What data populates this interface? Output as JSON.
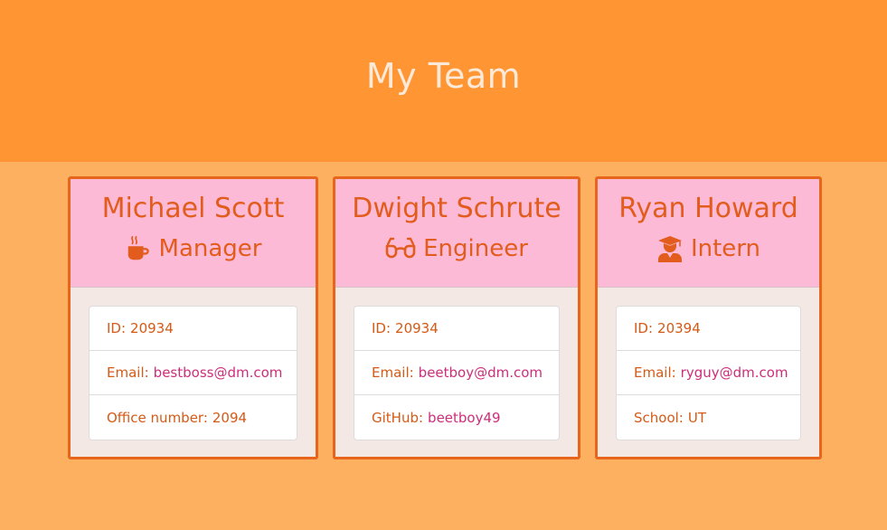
{
  "header": {
    "title": "My Team"
  },
  "colors": {
    "header_bg": "#ff9533",
    "page_bg": "#fdb160",
    "card_head_bg": "#fdbad6",
    "card_border": "#e8651c",
    "text_orange": "#e25c1d",
    "link_pink": "#cc2e7a"
  },
  "members": [
    {
      "name": "Michael Scott",
      "role": "Manager",
      "role_icon": "mug-hot-icon",
      "id_label": "ID:",
      "id": "20934",
      "email_label": "Email:",
      "email": "bestboss@dm.com",
      "extra_label": "Office number:",
      "extra_value": "2094"
    },
    {
      "name": "Dwight Schrute",
      "role": "Engineer",
      "role_icon": "glasses-icon",
      "id_label": "ID:",
      "id": "20934",
      "email_label": "Email:",
      "email": "beetboy@dm.com",
      "extra_label": "GitHub:",
      "extra_value": "beetboy49"
    },
    {
      "name": "Ryan Howard",
      "role": "Intern",
      "role_icon": "user-graduate-icon",
      "id_label": "ID:",
      "id": "20394",
      "email_label": "Email:",
      "email": "ryguy@dm.com",
      "extra_label": "School:",
      "extra_value": "UT"
    }
  ]
}
